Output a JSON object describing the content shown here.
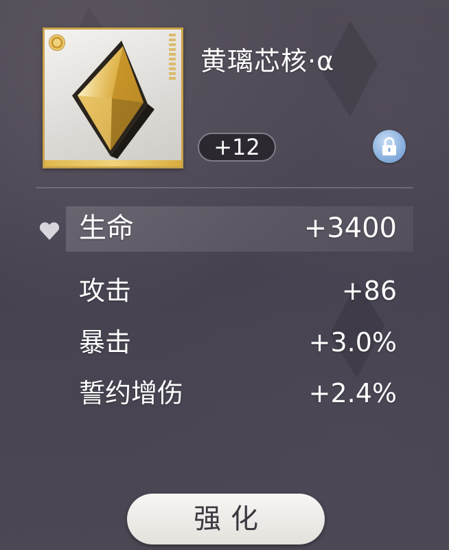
{
  "item": {
    "name": "黄璃芯核·α",
    "level": "+12",
    "icon": "gold-crystal-core-icon"
  },
  "stats": {
    "main": {
      "label": "生命",
      "value": "+3400"
    },
    "sub": [
      {
        "label": "攻击",
        "value": "+86"
      },
      {
        "label": "暴击",
        "value": "+3.0%"
      },
      {
        "label": "誓约增伤",
        "value": "+2.4%"
      }
    ]
  },
  "actions": {
    "enhance_label": "强化",
    "lock_icon": "lock-icon"
  },
  "colors": {
    "frame_gold": "#c9a34a",
    "lock_blue": "#7fa8d8",
    "panel_bg": "#4a4650"
  }
}
